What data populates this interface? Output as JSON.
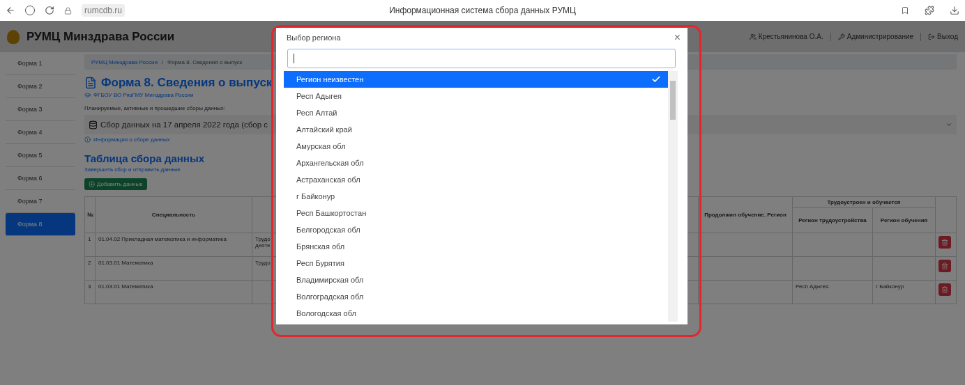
{
  "browser": {
    "address": "rumcdb.ru",
    "title": "Информационная система сбора данных РУМЦ"
  },
  "header": {
    "brand": "РУМЦ Минздрава России",
    "user": "Крестьянинова О.А.",
    "admin": "Администрирование",
    "logout": "Выход"
  },
  "sidebar": [
    {
      "label": "Форма 1",
      "selected": false
    },
    {
      "label": "Форма 2",
      "selected": false
    },
    {
      "label": "Форма 3",
      "selected": false
    },
    {
      "label": "Форма 4",
      "selected": false
    },
    {
      "label": "Форма 5",
      "selected": false
    },
    {
      "label": "Форма 6",
      "selected": false
    },
    {
      "label": "Форма 7",
      "selected": false
    },
    {
      "label": "Форма 8",
      "selected": true
    }
  ],
  "breadcrumb": {
    "separator": "/",
    "items": [
      "РУМЦ Минздрава России",
      "Форма 8. Сведения о выпуск"
    ]
  },
  "page": {
    "title": "Форма 8. Сведения о выпуск",
    "organization": "ФГБОУ ВО РязГМУ Минздрава России",
    "collections_label": "Планируемые, активные и прошедшие сборы данных:",
    "collection_select": "Сбор данных на 17 апреля 2022 года (сбор с",
    "info_link": "Информация о сборе данных",
    "table_title": "Таблица сбора данных",
    "finish_link": "Завершить сбор и отправить данные",
    "add_button": "Добавить данные"
  },
  "table": {
    "columns": {
      "number": "№",
      "specialty": "Специальность",
      "continued": "Продолжил обучение. Регион",
      "employed_group": "Трудоустроен и обучается",
      "employment_region": "Регион трудоустройства",
      "study_region": "Регион обучения"
    },
    "rows": [
      {
        "number": "1",
        "specialty": "01.04.02 Прикладная математика и информатика",
        "column_3": "Трудо деяте",
        "employment_region": "",
        "study_region": ""
      },
      {
        "number": "2",
        "specialty": "01.03.01 Математика",
        "column_3": "Трудо",
        "employment_region": "",
        "study_region": ""
      },
      {
        "number": "3",
        "specialty": "01.03.01 Математика",
        "column_3": "",
        "employment_region": "Респ Адыгея",
        "study_region": "г Байконур"
      }
    ]
  },
  "modal": {
    "title": "Выбор региона",
    "close": "×",
    "items": [
      {
        "label": "Регион неизвестен",
        "selected": true
      },
      {
        "label": "Респ Адыгея",
        "selected": false
      },
      {
        "label": "Респ Алтай",
        "selected": false
      },
      {
        "label": "Алтайский край",
        "selected": false
      },
      {
        "label": "Амурская обл",
        "selected": false
      },
      {
        "label": "Архангельская обл",
        "selected": false
      },
      {
        "label": "Астраханская обл",
        "selected": false
      },
      {
        "label": "г Байконур",
        "selected": false
      },
      {
        "label": "Респ Башкортостан",
        "selected": false
      },
      {
        "label": "Белгородская обл",
        "selected": false
      },
      {
        "label": "Брянская обл",
        "selected": false
      },
      {
        "label": "Респ Бурятия",
        "selected": false
      },
      {
        "label": "Владимирская обл",
        "selected": false
      },
      {
        "label": "Волгоградская обл",
        "selected": false
      },
      {
        "label": "Вологодская обл",
        "selected": false
      }
    ]
  }
}
